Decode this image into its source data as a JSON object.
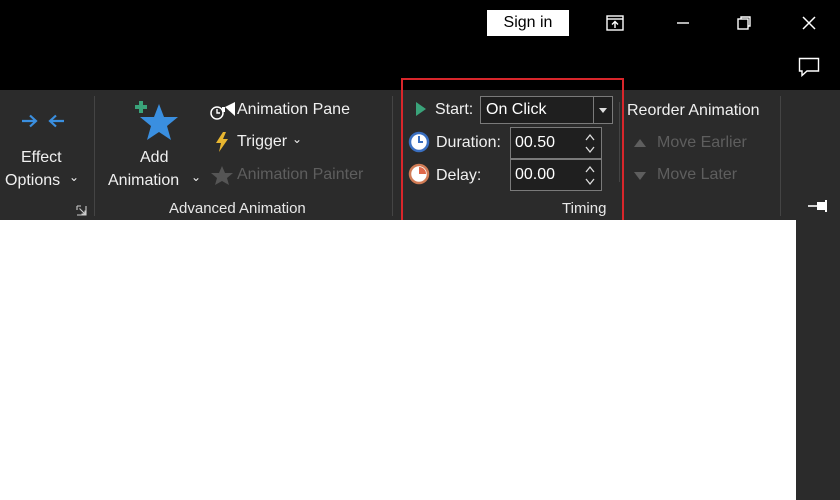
{
  "titlebar": {
    "sign_in_label": "Sign in",
    "buttons": [
      "ribbon-display-icon",
      "minimize-icon",
      "restore-icon",
      "close-icon"
    ],
    "comment_icon": "comment-icon"
  },
  "ribbon": {
    "effect_options": {
      "line1": "Effect",
      "line2": "Options",
      "caret": "⌄",
      "icon": "effect-arrows-icon"
    },
    "add_animation": {
      "line1": "Add",
      "line2": "Animation",
      "caret": "⌄",
      "icon": "add-star-icon"
    },
    "advanced": {
      "animation_pane": "Animation Pane",
      "trigger": "Trigger",
      "trigger_caret": "⌄",
      "animation_painter": "Animation Painter",
      "group_label": "Advanced Animation"
    },
    "timing": {
      "start_label": "Start:",
      "start_value": "On Click",
      "duration_label": "Duration:",
      "duration_value": "00.50",
      "delay_label": "Delay:",
      "delay_value": "00.00",
      "group_label": "Timing"
    },
    "reorder": {
      "title": "Reorder Animation",
      "move_earlier": "Move Earlier",
      "move_later": "Move Later"
    }
  },
  "colors": {
    "ribbon_bg": "#2b2b2b",
    "accent_blue": "#3a8fe0",
    "play_green": "#3aa37a",
    "highlight_red": "#d9262b"
  }
}
